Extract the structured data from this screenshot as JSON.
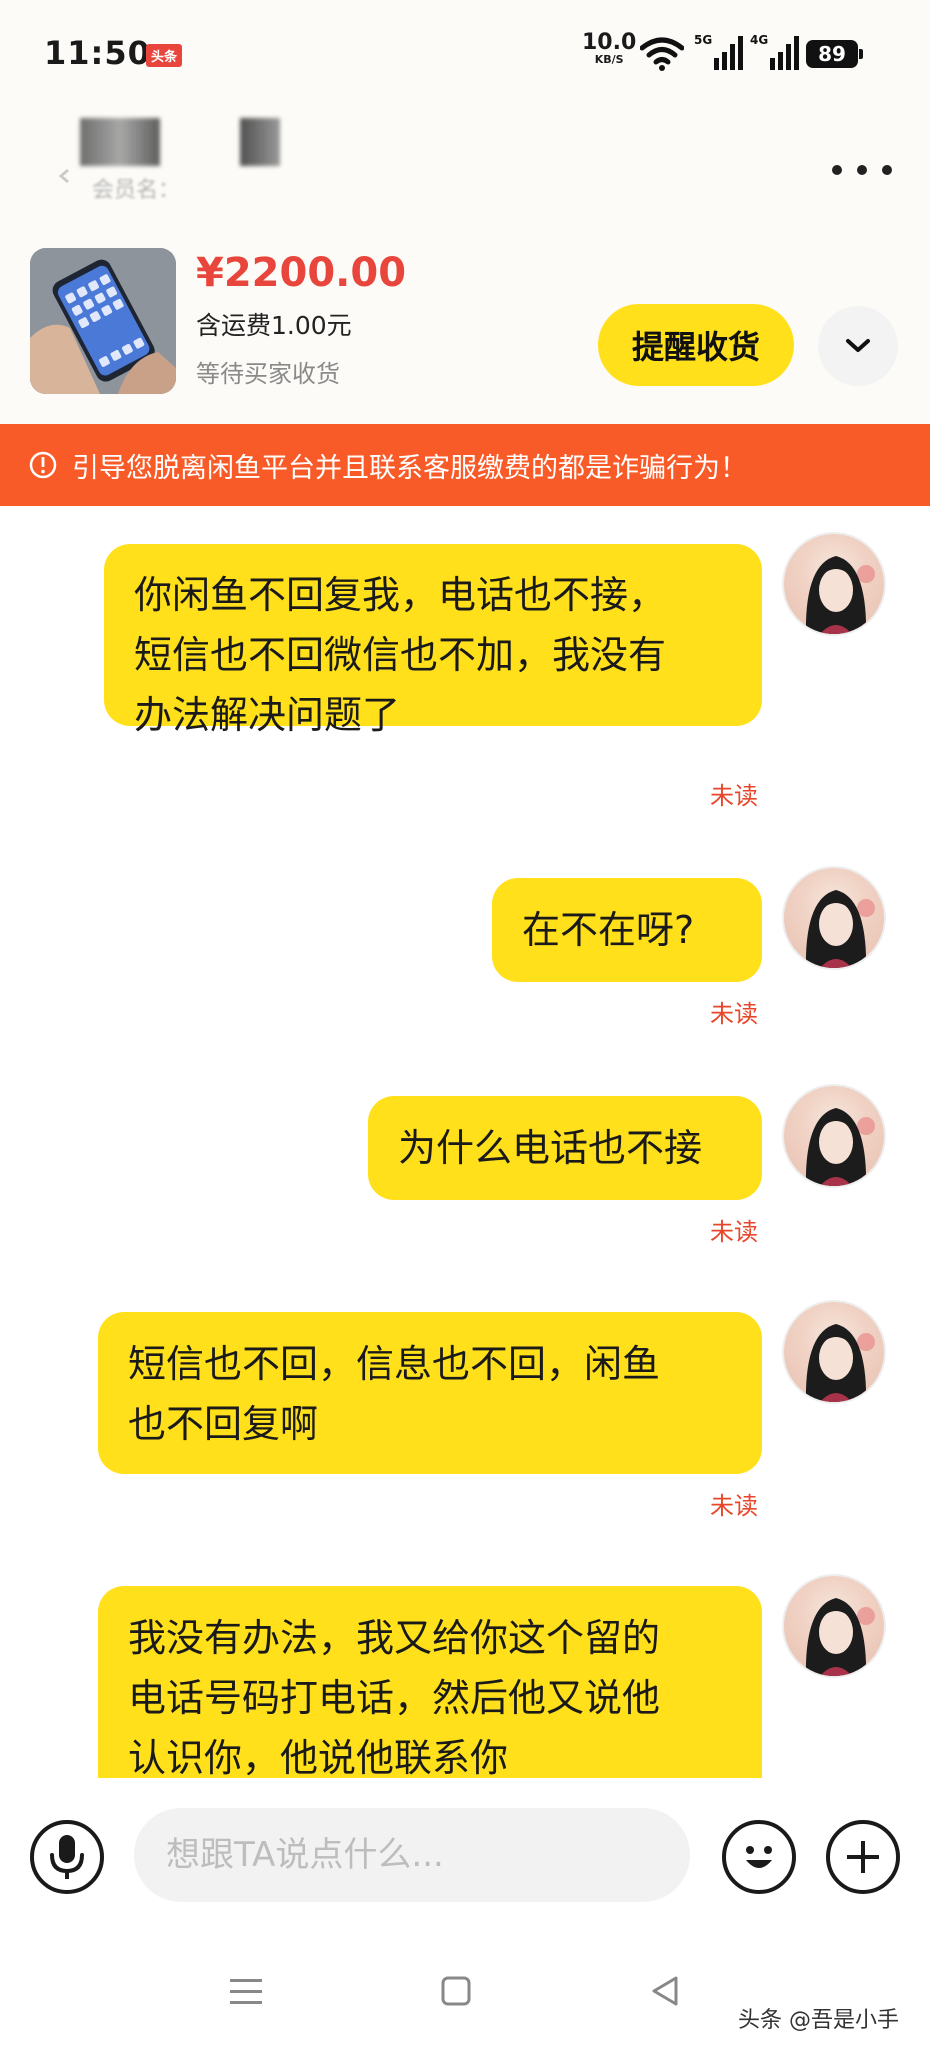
{
  "status_bar": {
    "time": "11:50",
    "app_badge": "头条",
    "net_speed_value": "10.0",
    "net_speed_unit": "KB/S",
    "signal_5g": "5G",
    "signal_4g": "4G",
    "battery": "89"
  },
  "header": {
    "subname": "会员名：",
    "more_icon": "more-dots-icon"
  },
  "product": {
    "price": "¥2200.00",
    "shipping": "含运费1.00元",
    "status": "等待买家收货",
    "remind_button": "提醒收货"
  },
  "warning": {
    "text": "引导您脱离闲鱼平台并且联系客服缴费的都是诈骗行为！"
  },
  "messages": [
    {
      "lines": [
        "你闲鱼不回复我，电话也不接，",
        "短信也不回微信也不加，我没有",
        "办法解决问题了"
      ],
      "status": "未读"
    },
    {
      "lines": [
        "在不在呀?"
      ],
      "status": "未读"
    },
    {
      "lines": [
        "为什么电话也不接"
      ],
      "status": "未读"
    },
    {
      "lines": [
        "短信也不回，信息也不回，闲鱼",
        "也不回复啊"
      ],
      "status": "未读"
    },
    {
      "lines": [
        "我没有办法，我又给你这个留的",
        "电话号码打电话，然后他又说他",
        "认识你，他说他联系你"
      ],
      "status": ""
    }
  ],
  "input": {
    "placeholder": "想跟TA说点什么..."
  },
  "watermark": "头条 @吾是小手",
  "colors": {
    "accent_yellow": "#ffe01a",
    "warning_orange": "#f95b28",
    "price_red": "#e8463c",
    "unread_red": "#e8462a"
  }
}
